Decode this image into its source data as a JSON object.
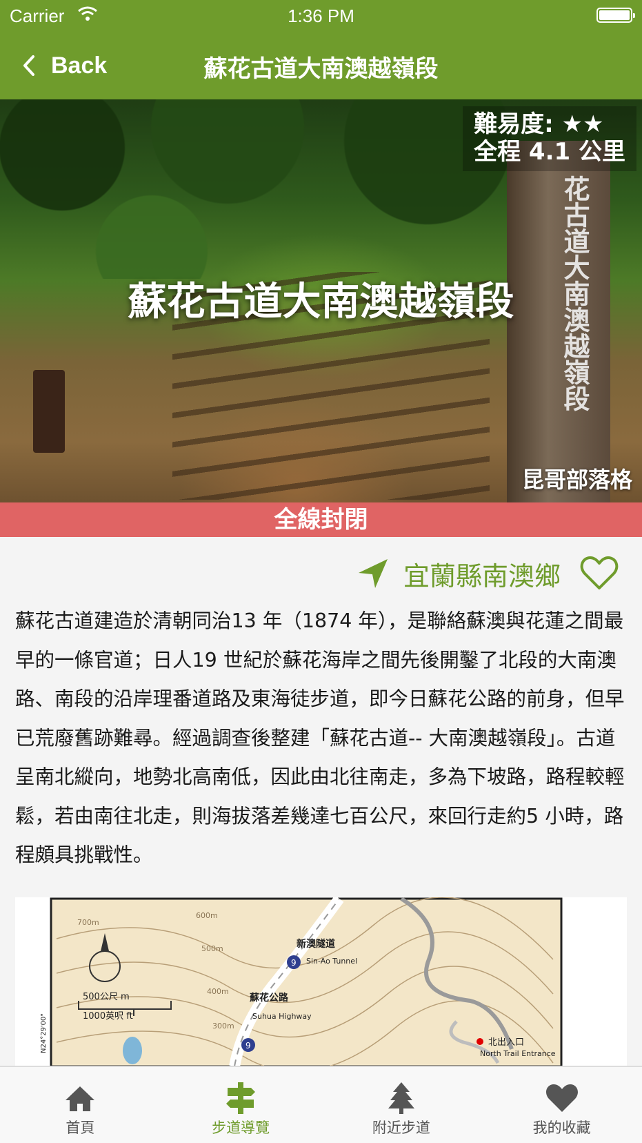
{
  "status_bar": {
    "carrier": "Carrier",
    "time": "1:36 PM"
  },
  "nav": {
    "back_label": "Back",
    "title": "蘇花古道大南澳越嶺段"
  },
  "hero": {
    "title": "蘇花古道大南澳越嶺段",
    "difficulty_label": "難易度: ★★",
    "distance_label": "全程 4.1 公里",
    "photo_credit": "昆哥部落格",
    "signpost_text": "花古道大南澳越嶺段"
  },
  "status_banner": {
    "text": "全線封閉",
    "color": "#e06464"
  },
  "location": {
    "text": "宜蘭縣南澳鄉"
  },
  "description": "蘇花古道建造於清朝同治13 年（1874 年），是聯絡蘇澳與花蓮之間最早的一條官道；日人19 世紀於蘇花海岸之間先後開鑿了北段的大南澳路、南段的沿岸理番道路及東海徒步道，即今日蘇花公路的前身，但早已荒廢舊跡難尋。經過調查後整建「蘇花古道-- 大南澳越嶺段」。古道呈南北縱向，地勢北高南低，因此由北往南走，多為下坡路，路程較輕鬆，若由南往北走，則海拔落差幾達七百公尺，來回行走約5 小時，路程頗具挑戰性。",
  "map": {
    "contour_labels": [
      "700m",
      "600m",
      "500m",
      "400m",
      "300m"
    ],
    "road_label_zh": "蘇花公路",
    "road_label_en": "Suhua Highway",
    "tunnel_label_zh": "新澳隧道",
    "tunnel_label_en": "Sin-Ao Tunnel",
    "route_number": "9",
    "scale_metric": "500公尺 m",
    "scale_imperial": "1000英呎 ft",
    "latitude": "N24°29'00\"",
    "entrance_label_zh": "北出入口",
    "entrance_label_en": "North Trail Entrance"
  },
  "tabs": [
    {
      "label": "首頁",
      "icon": "home-icon",
      "active": false
    },
    {
      "label": "步道導覽",
      "icon": "trail-sign-icon",
      "active": true
    },
    {
      "label": "附近步道",
      "icon": "tree-icon",
      "active": false
    },
    {
      "label": "我的收藏",
      "icon": "heart-icon",
      "active": false
    }
  ],
  "colors": {
    "brand": "#6f9c2c",
    "closed": "#e06464"
  }
}
